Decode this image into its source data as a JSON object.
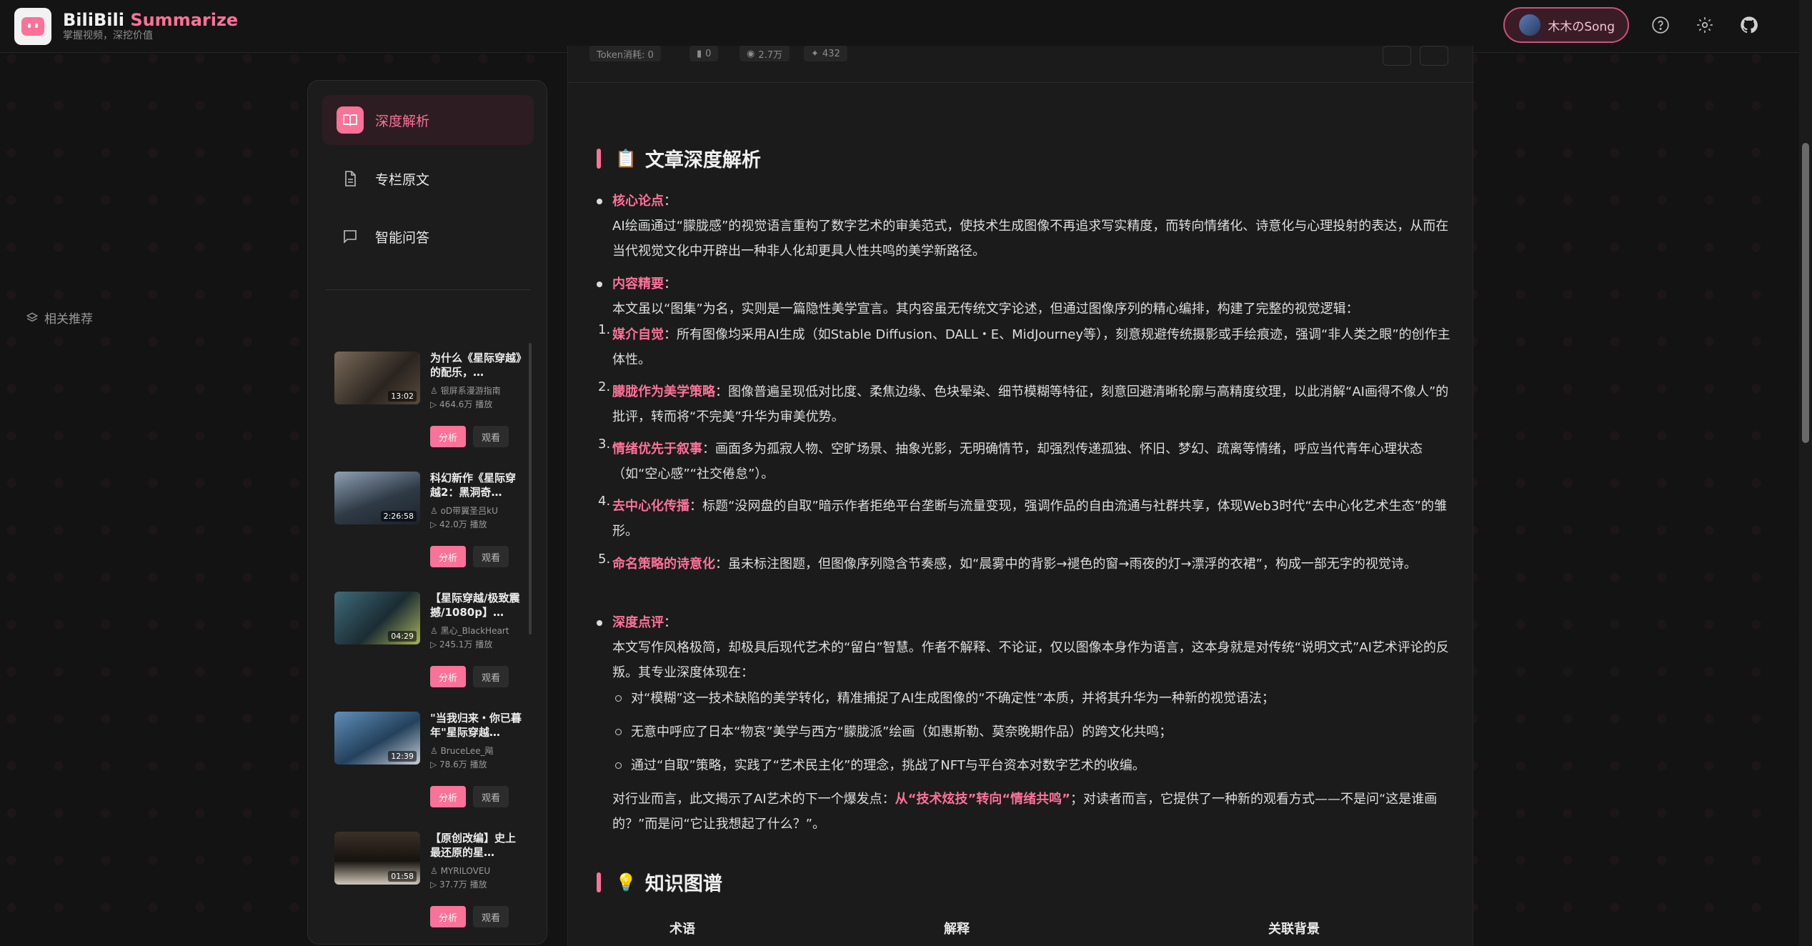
{
  "header": {
    "brand_name": "BiliBili",
    "brand_accent": "Summarize",
    "tagline": "掌握视频，深挖价值",
    "user_name": "木木のSong",
    "accent_color": "#fb7299"
  },
  "sidebar": {
    "nav": [
      {
        "label": "深度解析",
        "icon": "book-icon",
        "active": true
      },
      {
        "label": "专栏原文",
        "icon": "document-icon",
        "active": false
      },
      {
        "label": "智能问答",
        "icon": "chat-icon",
        "active": false
      }
    ],
    "recommend_title": "相关推荐",
    "analyze_label": "分析",
    "watch_label": "观看",
    "items": [
      {
        "title": "为什么《星际穿越》的配乐，…",
        "author": "银屏系漫游指南",
        "plays": "464.6万 播放",
        "duration": "13:02"
      },
      {
        "title": "科幻新作《星际穿越2：黑洞奇…",
        "author": "oD带翼圣吕kU",
        "plays": "42.0万 播放",
        "duration": "2:26:58"
      },
      {
        "title": "【星际穿越/极致震撼/1080p】…",
        "author": "黑心_BlackHeart",
        "plays": "245.1万 播放",
        "duration": "04:29"
      },
      {
        "title": "\"当我归来・你已暮年\"星际穿越…",
        "author": "BruceLee_飚",
        "plays": "78.6万 播放",
        "duration": "12:39"
      },
      {
        "title": "【原创改编】史上最还原的星…",
        "author": "MYRILOVEU",
        "plays": "37.7万 播放",
        "duration": "01:58"
      }
    ]
  },
  "stats": {
    "token": "Token消耗: 0",
    "s1": "0",
    "s2": "2.7万",
    "s3": "432"
  },
  "article": {
    "section1_emoji": "📋",
    "section1_title": "文章深度解析",
    "core_label": "核心论点",
    "core_text": "AI绘画通过“朦胧感”的视觉语言重构了数字艺术的审美范式，使技术生成图像不再追求写实精度，而转向情绪化、诗意化与心理投射的表达，从而在当代视觉文化中开辟出一种非人化却更具人性共鸣的美学新路径。",
    "summary_label": "内容精要",
    "summary_intro": "本文虽以“图集”为名，实则是一篇隐性美学宣言。其内容虽无传统文字论述，但通过图像序列的精心编排，构建了完整的视觉逻辑：",
    "points": [
      {
        "n": "1.",
        "label": "媒介自觉",
        "text": "所有图像均采用AI生成（如Stable Diffusion、DALL・E、MidJourney等），刻意规避传统摄影或手绘痕迹，强调“非人类之眼”的创作主体性。"
      },
      {
        "n": "2.",
        "label": "朦胧作为美学策略",
        "text": "图像普遍呈现低对比度、柔焦边缘、色块晕染、细节模糊等特征，刻意回避清晰轮廓与高精度纹理，以此消解“AI画得不像人”的批评，转而将“不完美”升华为审美优势。"
      },
      {
        "n": "3.",
        "label": "情绪优先于叙事",
        "text": "画面多为孤寂人物、空旷场景、抽象光影，无明确情节，却强烈传递孤独、怀旧、梦幻、疏离等情绪，呼应当代青年心理状态（如“空心感”“社交倦怠”）。"
      },
      {
        "n": "4.",
        "label": "去中心化传播",
        "text": "标题“没网盘的自取”暗示作者拒绝平台垄断与流量变现，强调作品的自由流通与社群共享，体现Web3时代“去中心化艺术生态”的雏形。"
      },
      {
        "n": "5.",
        "label": "命名策略的诗意化",
        "text": "虽未标注图题，但图像序列隐含节奏感，如“晨雾中的背影→褪色的窗→雨夜的灯→漂浮的衣裙”，构成一部无字的视觉诗。"
      }
    ],
    "review_label": "深度点评",
    "review_text": "本文写作风格极简，却极具后现代艺术的“留白”智慧。作者不解释、不论证，仅以图像本身作为语言，这本身就是对传统“说明文式”AI艺术评论的反叛。其专业深度体现在：",
    "review_points": [
      "对“模糊”这一技术缺陷的美学转化，精准捕捉了AI生成图像的“不确定性”本质，并将其升华为一种新的视觉语法；",
      "无意中呼应了日本“物哀”美学与西方“朦胧派”绘画（如惠斯勒、莫奈晚期作品）的跨文化共鸣；",
      "通过“自取”策略，实践了“艺术民主化”的理念，挑战了NFT与平台资本对数字艺术的收编。"
    ],
    "conclusion_pre": "对行业而言，此文揭示了AI艺术的下一个爆发点：",
    "conclusion_highlight": "从“技术炫技”转向“情绪共鸣”",
    "conclusion_post": "；对读者而言，它提供了一种新的观看方式——不是问“这是谁画的？”而是问“它让我想起了什么？”。",
    "section2_emoji": "💡",
    "section2_title": "知识图谱",
    "table_headers": [
      "术语",
      "解释",
      "关联背景"
    ]
  }
}
